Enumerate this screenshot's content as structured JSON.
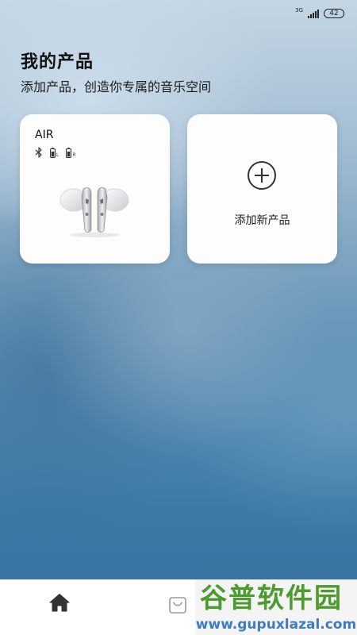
{
  "status_bar": {
    "network": "3G",
    "battery": "42",
    "icons": [
      "signal-icon",
      "battery-icon"
    ]
  },
  "header": {
    "title": "我的产品",
    "subtitle": "添加产品，创造你专属的音乐空间"
  },
  "products": [
    {
      "name": "AIR",
      "status_icons": [
        "bluetooth-icon",
        "battery-left-icon",
        "battery-right-icon"
      ],
      "left_label": "L",
      "right_label": "R",
      "image": "earbuds-image"
    }
  ],
  "add_card": {
    "icon": "plus-circle-icon",
    "label": "添加新产品"
  },
  "bottom_nav": {
    "items": [
      {
        "icon": "home-icon",
        "active": true
      },
      {
        "icon": "shopping-bag-icon",
        "active": false
      }
    ]
  },
  "watermark": {
    "text": "谷普软件园",
    "url": "www.gupuxlazal.com"
  },
  "colors": {
    "card_bg": "#fdfdfd",
    "nav_bg": "#ffffff",
    "watermark_green": "#4d9a2f",
    "watermark_blue": "#3d7bc4"
  }
}
